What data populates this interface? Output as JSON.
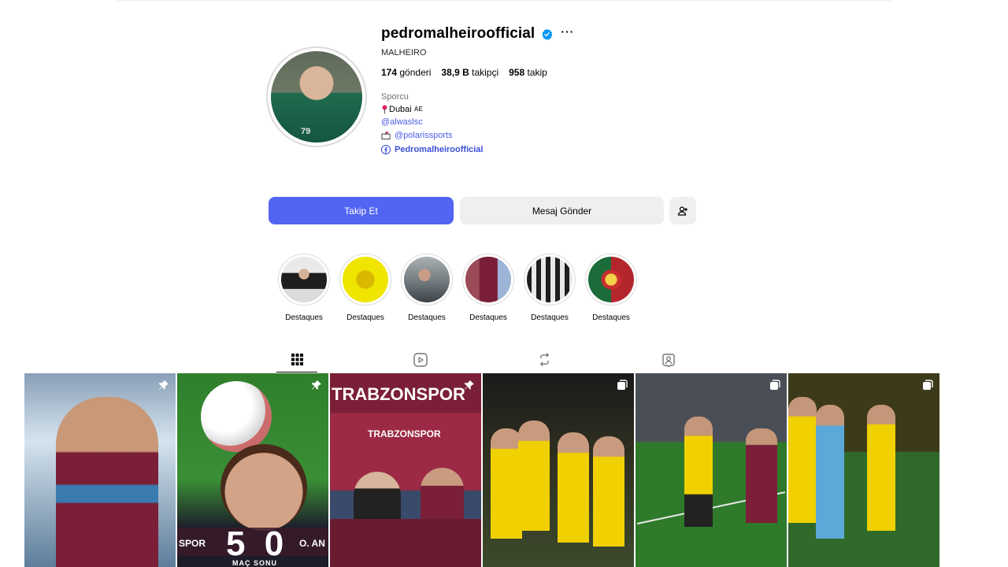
{
  "profile": {
    "username": "pedromalheiroofficial",
    "full_name": "MALHEIRO",
    "stats": {
      "posts_count": "174",
      "posts_label": "gönderi",
      "followers_count": "38,9 B",
      "followers_label": "takipçi",
      "following_count": "958",
      "following_label": "takip"
    },
    "category": "Sporcu",
    "location": "Dubai",
    "location_flag": "AE",
    "club_link": "@alwaslsc",
    "agency_link": "@polarissports",
    "facebook_link": "Pedromalheiroofficial",
    "more_label": "···"
  },
  "actions": {
    "follow_label": "Takip Et",
    "message_label": "Mesaj Gönder"
  },
  "highlights": [
    {
      "label": "Destaques"
    },
    {
      "label": "Destaques"
    },
    {
      "label": "Destaques"
    },
    {
      "label": "Destaques"
    },
    {
      "label": "Destaques"
    },
    {
      "label": "Destaques"
    }
  ],
  "posts": {
    "p2_score": "5 0",
    "p2_left_text": "SPOR",
    "p2_right_text": "O. AN",
    "p2_caption": "MAÇ SONU",
    "p3_title": "TRABZONSPOR",
    "p3_subtitle": "TRABZONSPOR"
  },
  "colors": {
    "accent": "#5164f2",
    "link": "#4a5de8",
    "verified": "#0095f6",
    "secondary_button": "#efefef"
  },
  "icons": {
    "verified": "verified-badge-icon",
    "grid": "grid-icon",
    "reels": "reels-icon",
    "reposts": "repost-icon",
    "tagged": "tagged-icon",
    "pin": "pin-icon",
    "carousel": "carousel-icon"
  }
}
